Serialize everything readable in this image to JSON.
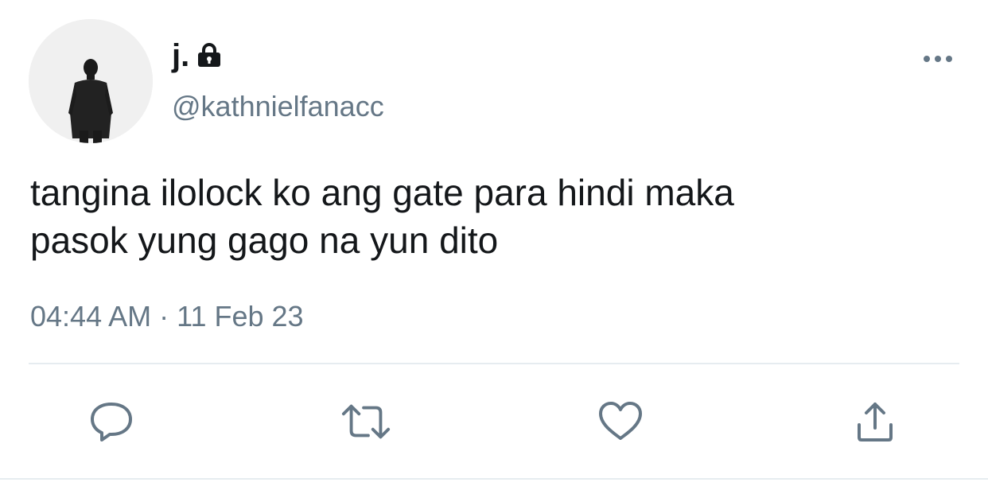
{
  "user": {
    "display_name": "j.",
    "handle": "@kathnielfanacc",
    "protected_icon": "lock-icon",
    "avatar": "silhouette-man-in-suit"
  },
  "tweet": {
    "text_line1": "tangina ilolock ko ang gate para hindi maka",
    "text_line2": "pasok yung gago na yun dito",
    "time": "04:44 AM",
    "separator": "·",
    "date": "11 Feb 23"
  },
  "actions": [
    {
      "icon": "reply-icon"
    },
    {
      "icon": "retweet-icon"
    },
    {
      "icon": "like-icon"
    },
    {
      "icon": "share-icon"
    }
  ],
  "colors": {
    "text": "#14171a",
    "secondary": "#657786",
    "icon": "#657786",
    "divider": "#e6ecf0"
  }
}
